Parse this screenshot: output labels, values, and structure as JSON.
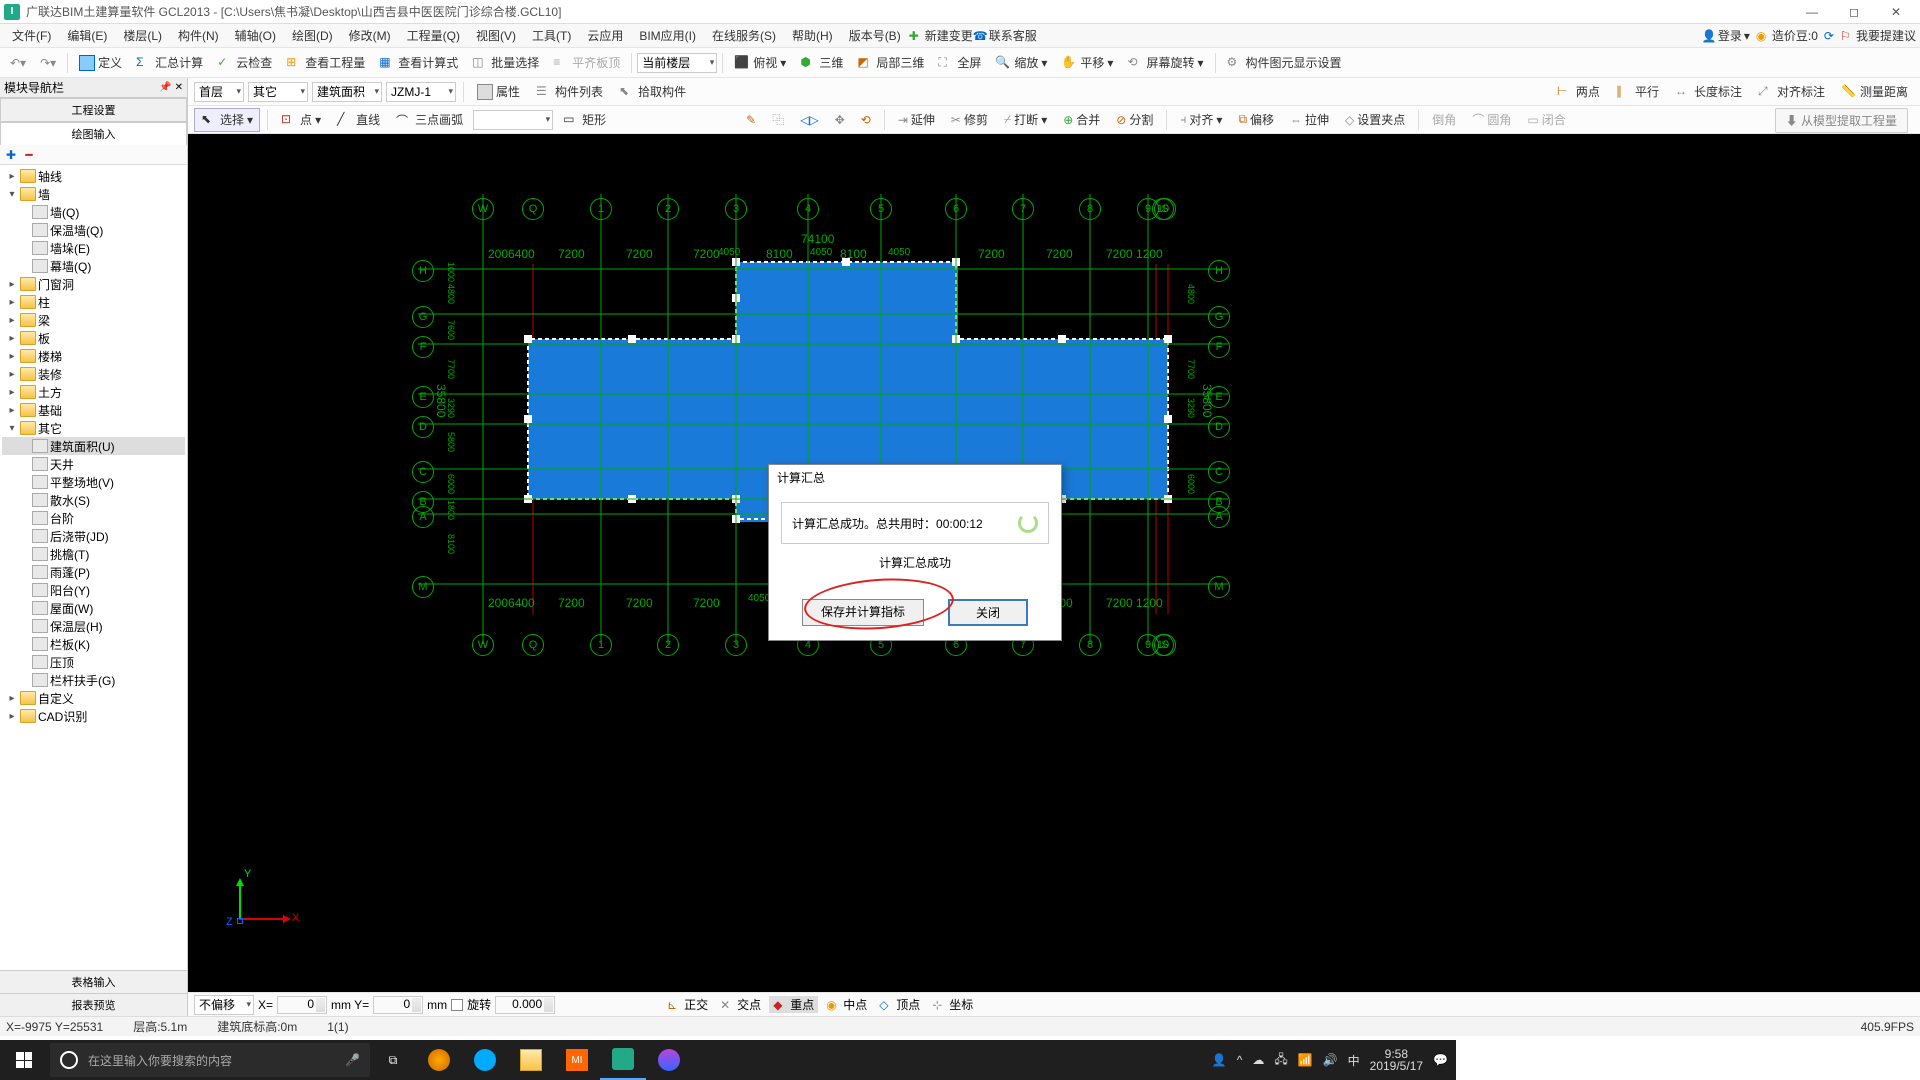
{
  "titlebar": {
    "app": "广联达BIM土建算量软件 GCL2013",
    "path": "[C:\\Users\\焦书凝\\Desktop\\山西吉县中医医院门诊综合楼.GCL10]"
  },
  "menu": {
    "items": [
      "文件(F)",
      "编辑(E)",
      "楼层(L)",
      "构件(N)",
      "辅轴(O)",
      "绘图(D)",
      "修改(M)",
      "工程量(Q)",
      "视图(V)",
      "工具(T)",
      "云应用",
      "BIM应用(I)",
      "在线服务(S)",
      "帮助(H)",
      "版本号(B)"
    ],
    "new": "新建变更",
    "cs": "联系客服",
    "login": "登录",
    "coin": "造价豆:0",
    "sugg": "我要提建议"
  },
  "tb1": {
    "def": "定义",
    "sum": "汇总计算",
    "chk": "云检查",
    "qview": "查看工程量",
    "cview": "查看计算式",
    "bsel": "批量选择",
    "flat": "平齐板顶",
    "cur": "当前楼层",
    "persp": "俯视",
    "td": "三维",
    "local": "局部三维",
    "full": "全屏",
    "zoom": "缩放",
    "pan": "平移",
    "scr": "屏幕旋转",
    "disp": "构件图元显示设置"
  },
  "tb2": {
    "floor": "首层",
    "cat": "其它",
    "type": "建筑面积",
    "code": "JZMJ-1",
    "props": "属性",
    "clist": "构件列表",
    "pick": "拾取构件",
    "tp": "两点",
    "parl": "平行",
    "ldim": "长度标注",
    "align": "对齐标注",
    "mdist": "测量距离"
  },
  "tb3": {
    "sel": "选择",
    "pt": "点",
    "line": "直线",
    "arc": "三点画弧",
    "rect": "矩形",
    "ext": "延伸",
    "trim": "修剪",
    "brk": "打断",
    "merge": "合并",
    "split": "分割",
    "al": "对齐",
    "off": "偏移",
    "str": "拉伸",
    "grip": "设置夹点",
    "cham": "倒角",
    "fil": "圆角",
    "close": "闭合",
    "extract": "从模型提取工程量"
  },
  "sidebar": {
    "header": "模块导航栏",
    "t1": "工程设置",
    "t2": "绘图输入",
    "bt1": "表格输入",
    "bt2": "报表预览",
    "tree": [
      {
        "l": 0,
        "e": "▸",
        "i": "f",
        "t": "轴线"
      },
      {
        "l": 0,
        "e": "▾",
        "i": "f",
        "t": "墙"
      },
      {
        "l": 1,
        "e": "",
        "i": "c",
        "t": "墙(Q)"
      },
      {
        "l": 1,
        "e": "",
        "i": "c",
        "t": "保温墙(Q)"
      },
      {
        "l": 1,
        "e": "",
        "i": "c",
        "t": "墙垛(E)"
      },
      {
        "l": 1,
        "e": "",
        "i": "c",
        "t": "幕墙(Q)"
      },
      {
        "l": 0,
        "e": "▸",
        "i": "f",
        "t": "门窗洞"
      },
      {
        "l": 0,
        "e": "▸",
        "i": "f",
        "t": "柱"
      },
      {
        "l": 0,
        "e": "▸",
        "i": "f",
        "t": "梁"
      },
      {
        "l": 0,
        "e": "▸",
        "i": "f",
        "t": "板"
      },
      {
        "l": 0,
        "e": "▸",
        "i": "f",
        "t": "楼梯"
      },
      {
        "l": 0,
        "e": "▸",
        "i": "f",
        "t": "装修"
      },
      {
        "l": 0,
        "e": "▸",
        "i": "f",
        "t": "土方"
      },
      {
        "l": 0,
        "e": "▸",
        "i": "f",
        "t": "基础"
      },
      {
        "l": 0,
        "e": "▾",
        "i": "f",
        "t": "其它"
      },
      {
        "l": 1,
        "e": "",
        "i": "c",
        "t": "建筑面积(U)",
        "sel": true
      },
      {
        "l": 1,
        "e": "",
        "i": "c",
        "t": "天井"
      },
      {
        "l": 1,
        "e": "",
        "i": "c",
        "t": "平整场地(V)"
      },
      {
        "l": 1,
        "e": "",
        "i": "c",
        "t": "散水(S)"
      },
      {
        "l": 1,
        "e": "",
        "i": "c",
        "t": "台阶"
      },
      {
        "l": 1,
        "e": "",
        "i": "c",
        "t": "后浇带(JD)"
      },
      {
        "l": 1,
        "e": "",
        "i": "c",
        "t": "挑檐(T)"
      },
      {
        "l": 1,
        "e": "",
        "i": "c",
        "t": "雨蓬(P)"
      },
      {
        "l": 1,
        "e": "",
        "i": "c",
        "t": "阳台(Y)"
      },
      {
        "l": 1,
        "e": "",
        "i": "c",
        "t": "屋面(W)"
      },
      {
        "l": 1,
        "e": "",
        "i": "c",
        "t": "保温层(H)"
      },
      {
        "l": 1,
        "e": "",
        "i": "c",
        "t": "栏板(K)"
      },
      {
        "l": 1,
        "e": "",
        "i": "c",
        "t": "压顶"
      },
      {
        "l": 1,
        "e": "",
        "i": "c",
        "t": "栏杆扶手(G)"
      },
      {
        "l": 0,
        "e": "▸",
        "i": "f",
        "t": "自定义"
      },
      {
        "l": 0,
        "e": "▸",
        "i": "f",
        "t": "CAD识别"
      }
    ]
  },
  "canvas": {
    "topnums": [
      "1",
      "2",
      "3",
      "4",
      "5",
      "6",
      "7",
      "8",
      "9",
      "10"
    ],
    "topL": [
      "W",
      "Q"
    ],
    "topR": [
      "S"
    ],
    "left": [
      "H",
      "G",
      "F",
      "E",
      "D",
      "C",
      "B",
      "A",
      "M"
    ],
    "dimsTop": [
      "2006400",
      "7200",
      "7200",
      "7200",
      "4050",
      "8100",
      "4050",
      "8100",
      "4050",
      "7200",
      "7200",
      "7200 1200"
    ],
    "total": "74100",
    "dimsLeft": [
      "1000",
      "4800",
      "7600",
      "7700",
      "3290",
      "5800",
      "6000",
      "1800",
      "8100"
    ],
    "leftTotal": "35800"
  },
  "dialog": {
    "title": "计算汇总",
    "msg": "计算汇总成功。总共用时：",
    "time": "00:00:12",
    "succ": "计算汇总成功",
    "save": "保存并计算指标",
    "close": "关闭"
  },
  "bottom": {
    "nos": "不偏移",
    "x": "X=",
    "y": "mm Y=",
    "mm": "mm",
    "rot": "旋转",
    "rval": "0.000",
    "o": "正交",
    "i": "交点",
    "m": "重点",
    "c": "中点",
    "v": "顶点",
    "co": "坐标"
  },
  "status": {
    "xy": "X=-9975 Y=25531",
    "fh": "层高:5.1m",
    "be": "建筑底标高:0m",
    "pg": "1(1)",
    "fps": "405.9FPS"
  },
  "taskbar": {
    "search": "在这里输入你要搜索的内容",
    "time": "9:58",
    "date": "2019/5/17"
  }
}
